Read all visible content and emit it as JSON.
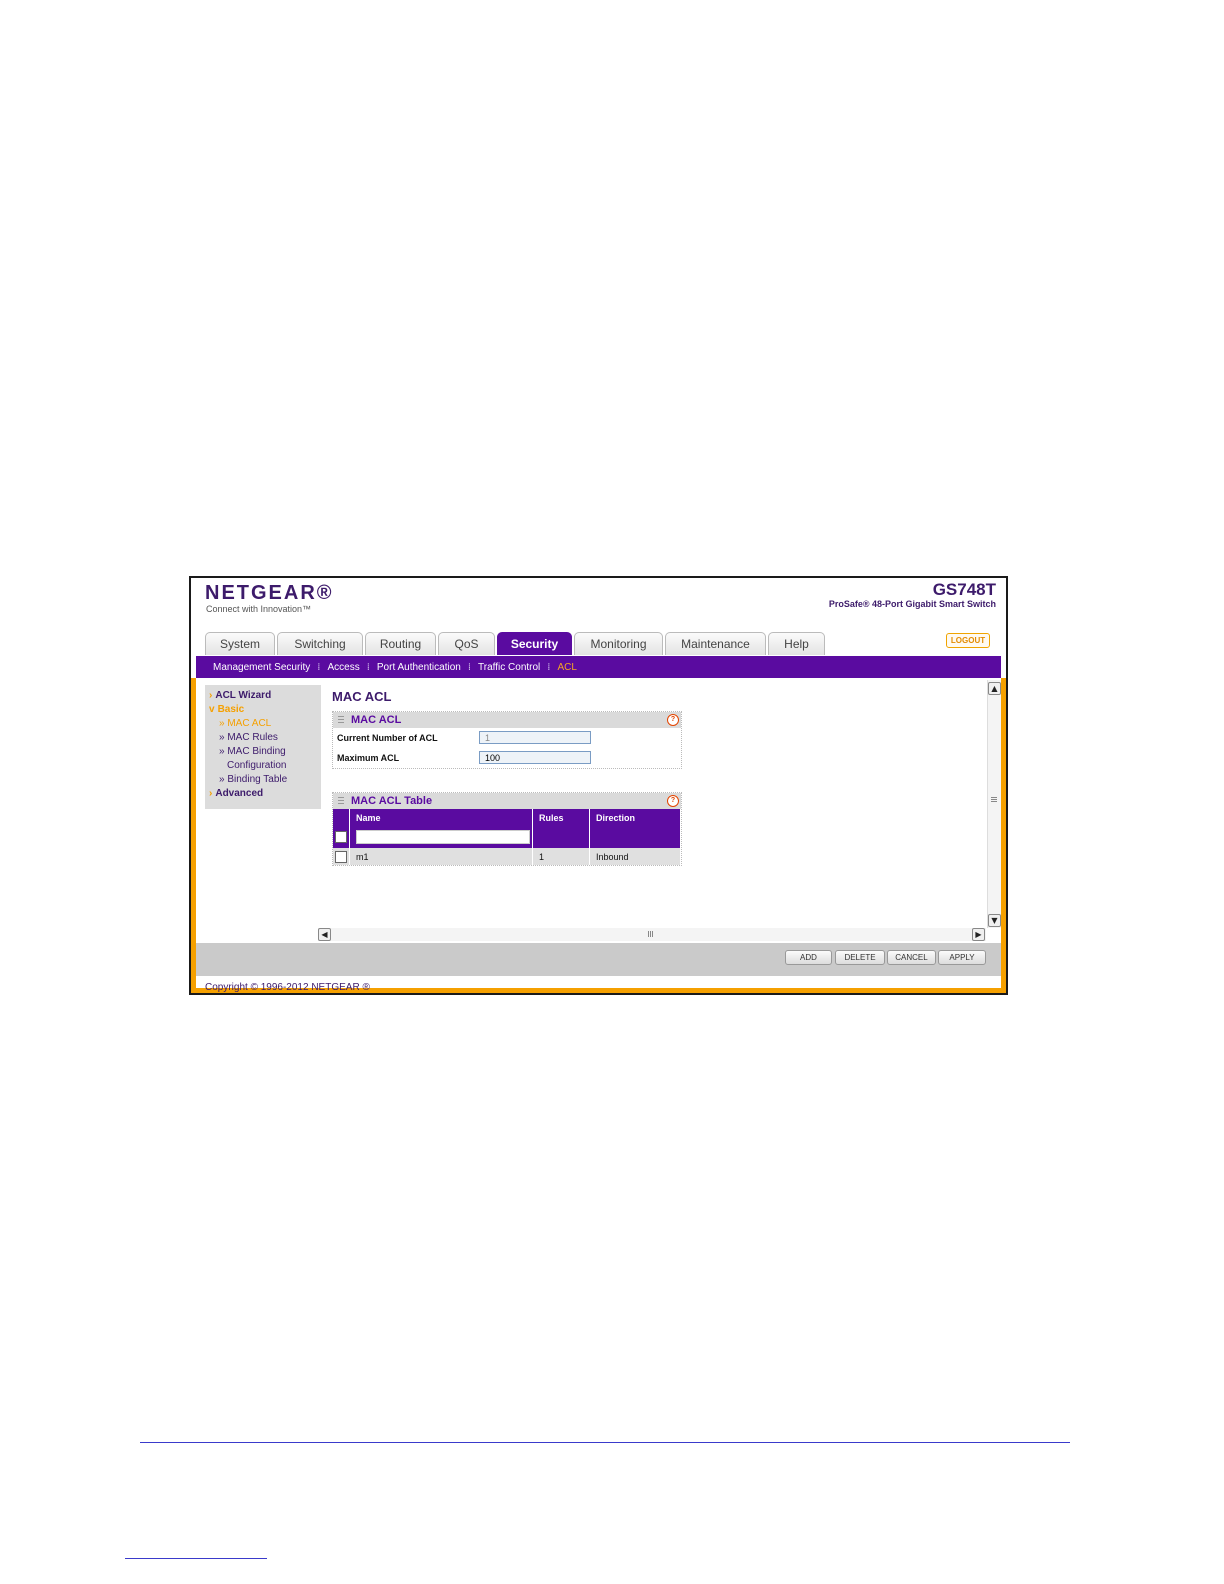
{
  "header": {
    "logo": "NETGEAR®",
    "tagline": "Connect with Innovation™",
    "model": "GS748T",
    "description": "ProSafe® 48-Port Gigabit Smart Switch",
    "logout_label": "LOGOUT"
  },
  "tabs": [
    "System",
    "Switching",
    "Routing",
    "QoS",
    "Security",
    "Monitoring",
    "Maintenance",
    "Help"
  ],
  "active_tab": "Security",
  "subnav": [
    "Management Security",
    "Access",
    "Port Authentication",
    "Traffic Control",
    "ACL"
  ],
  "active_subnav": "ACL",
  "sidebar": {
    "acl_wizard": "ACL Wizard",
    "basic": "Basic",
    "mac_acl": "MAC ACL",
    "mac_rules": "MAC Rules",
    "mac_binding": "MAC Binding",
    "mac_binding_cont": "Configuration",
    "binding_table": "Binding Table",
    "advanced": "Advanced"
  },
  "page_title": "MAC ACL",
  "mac_acl_panel": {
    "title": "MAC ACL",
    "current_label": "Current Number of ACL",
    "current_value": "1",
    "max_label": "Maximum ACL",
    "max_value": "100"
  },
  "mac_acl_table": {
    "title": "MAC ACL Table",
    "columns": [
      "Name",
      "Rules",
      "Direction"
    ],
    "rows": [
      {
        "name": "m1",
        "rules": "1",
        "direction": "Inbound"
      }
    ]
  },
  "buttons": {
    "add": "ADD",
    "delete": "DELETE",
    "cancel": "CANCEL",
    "apply": "APPLY"
  },
  "footer": {
    "copyright": "Copyright © 1996-2012 NETGEAR ®"
  },
  "colors": {
    "accent_purple": "#5a0ba0",
    "accent_orange": "#f5a000",
    "text_purple": "#3d1b6b"
  }
}
